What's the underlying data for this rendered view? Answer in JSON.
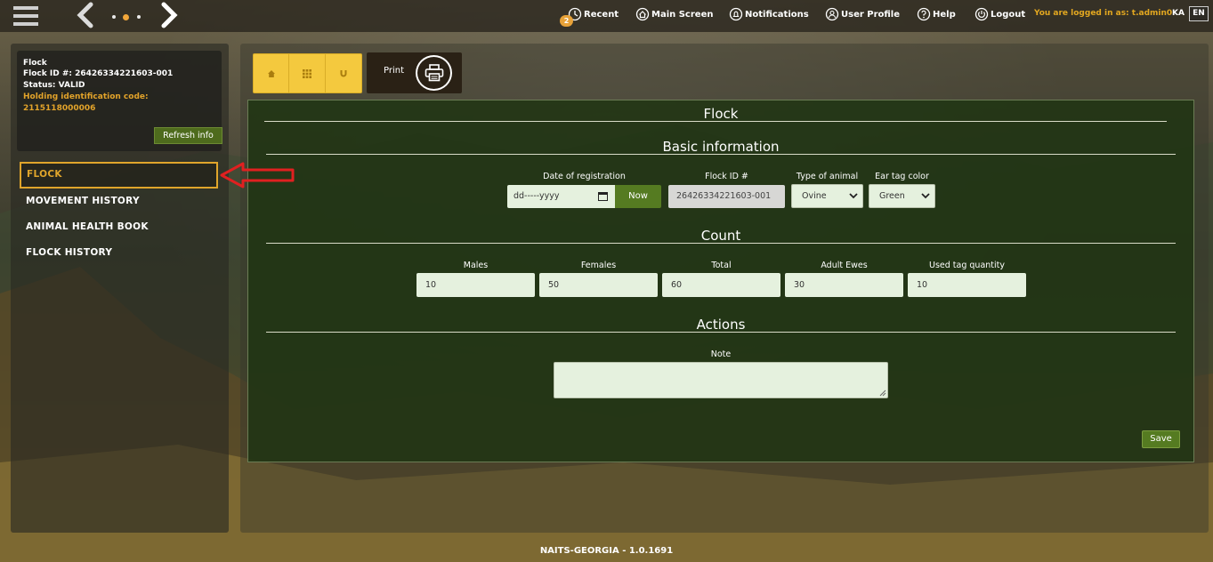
{
  "topbar": {
    "recent": "Recent",
    "recent_badge": "2",
    "main_screen": "Main Screen",
    "notifications": "Notifications",
    "user_profile": "User Profile",
    "help": "Help",
    "logout": "Logout",
    "logged_in_as": "You are logged in as: t.admin0",
    "lang_ka": "KA",
    "lang_en": "EN"
  },
  "info": {
    "line1": "Flock",
    "line2": "Flock ID #: 26426334221603-001",
    "line3": "Status: VALID",
    "line4": "Holding identification code:",
    "line5": "2115118000006",
    "refresh_label": "Refresh info"
  },
  "sidebar": {
    "items": [
      {
        "label": "FLOCK",
        "active": true
      },
      {
        "label": "MOVEMENT HISTORY"
      },
      {
        "label": "ANIMAL HEALTH BOOK"
      },
      {
        "label": "FLOCK HISTORY"
      }
    ]
  },
  "toolbar": {
    "print_label": "Print",
    "icons": [
      "home-icon",
      "grid-icon",
      "magnet-icon",
      "printer-icon"
    ]
  },
  "form": {
    "title": "Flock",
    "basic_title": "Basic information",
    "date_label": "Date of registration",
    "date_placeholder": "dd-----yyyy",
    "now_label": "Now",
    "flock_id_label": "Flock ID #",
    "flock_id_value": "26426334221603-001",
    "animal_type_label": "Type of animal",
    "animal_type_value": "Ovine",
    "ear_tag_label": "Ear tag color",
    "ear_tag_value": "Green",
    "count_title": "Count",
    "counts": [
      {
        "label": "Males",
        "value": "10"
      },
      {
        "label": "Females",
        "value": "50"
      },
      {
        "label": "Total",
        "value": "60"
      },
      {
        "label": "Adult Ewes",
        "value": "30"
      },
      {
        "label": "Used tag quantity",
        "value": "10"
      }
    ],
    "actions_title": "Actions",
    "note_label": "Note",
    "note_value": "",
    "save_label": "Save"
  },
  "footer": {
    "version": "NAITS-GEORGIA - 1.0.1691"
  },
  "colors": {
    "accent": "#e0a52b",
    "green_button": "#557b21",
    "form_bg": "#1f3413",
    "yellow_group": "#f4c93e"
  }
}
